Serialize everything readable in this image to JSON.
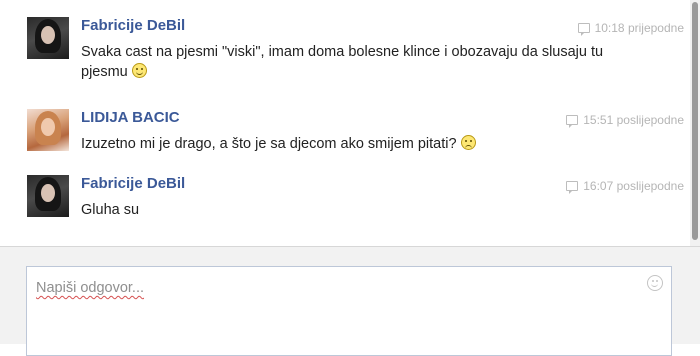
{
  "messages": [
    {
      "author": "Fabricije DeBil",
      "time": "10:18 prijepodne",
      "text": "Svaka cast na pjesmi \"viski\", imam doma bolesne klince i obozavaju da slusaju tu pjesmu",
      "emoticon": "smile",
      "avatar": "dark-portrait"
    },
    {
      "author": "LIDIJA BACIC",
      "time": "15:51 poslijepodne",
      "text": "Izuzetno mi je drago, a što je sa djecom ako smijem pitati?",
      "emoticon": "frown",
      "avatar": "blonde-portrait"
    },
    {
      "author": "Fabricije DeBil",
      "time": "16:07 poslijepodne",
      "text": "Gluha su",
      "avatar": "dark-portrait"
    }
  ],
  "reply": {
    "placeholder": "Napiši odgovor..."
  },
  "colors": {
    "author_link": "#3b5998",
    "timestamp": "#b5b5b5",
    "reply_background": "#f2f2f2",
    "textbox_border": "#bdc7d8"
  }
}
